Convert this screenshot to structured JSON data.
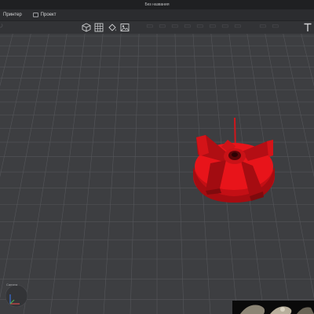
{
  "window": {
    "title": "Без названия"
  },
  "menu": {
    "items": [
      {
        "label": "Принтер"
      },
      {
        "label": "Проект"
      }
    ]
  },
  "toolbar": {
    "icons": [
      "cube-view-icon",
      "grid-view-icon",
      "paint-bucket-icon",
      "image-icon",
      "text-tool-icon"
    ]
  },
  "viewport": {
    "model_color": "#e8141a",
    "grid_color": "#55565a",
    "background": "#3d3e41"
  },
  "axes_widget": {
    "label": "Camera"
  },
  "colors": {
    "accent": "#e8141a"
  }
}
